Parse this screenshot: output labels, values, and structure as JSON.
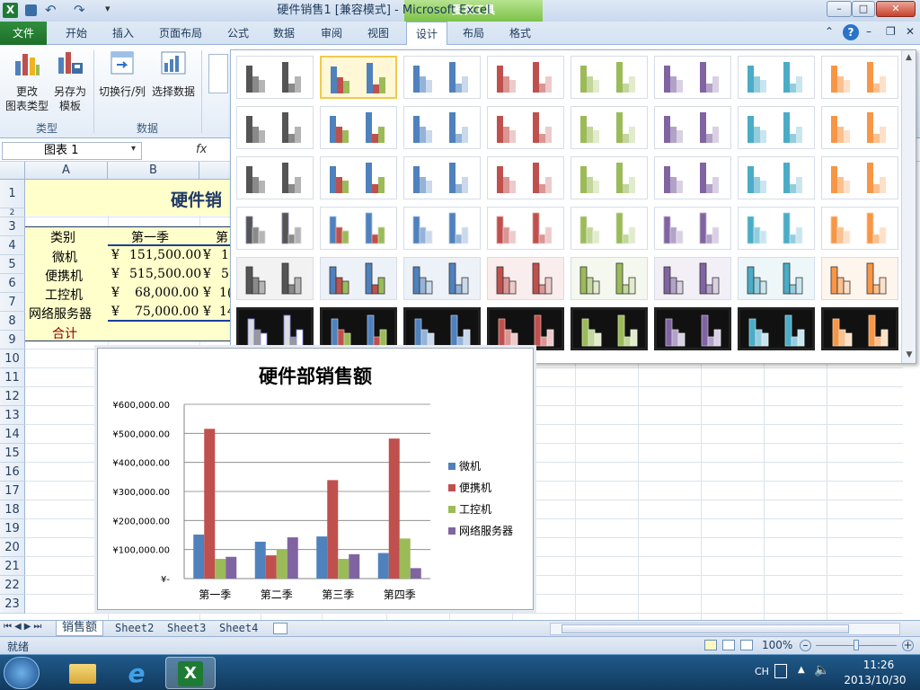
{
  "window": {
    "title": "硬件销售1 [兼容模式] - Microsoft Excel",
    "context_header": "图表工具",
    "controls": {
      "minimize": "–",
      "maximize": "□",
      "close": "✕"
    }
  },
  "ribbon_tabs": [
    {
      "label": "文件"
    },
    {
      "label": "开始"
    },
    {
      "label": "插入"
    },
    {
      "label": "页面布局"
    },
    {
      "label": "公式"
    },
    {
      "label": "数据"
    },
    {
      "label": "审阅"
    },
    {
      "label": "视图"
    },
    {
      "label": "设计"
    },
    {
      "label": "布局"
    },
    {
      "label": "格式"
    }
  ],
  "ribbon": {
    "change_type_label": "更改\n图表类型",
    "save_template_label": "另存为\n模板",
    "switch_row_col_label": "切换行/列",
    "select_data_label": "选择数据",
    "group_type": "类型",
    "group_data": "数据"
  },
  "formula_bar": {
    "name_box": "图表 1",
    "fx": "fx"
  },
  "sheet": {
    "columns": [
      "A",
      "B"
    ],
    "rows": [
      "1",
      "2",
      "3",
      "4",
      "5",
      "6",
      "7",
      "8",
      "9",
      "10",
      "11",
      "12",
      "13",
      "14",
      "15",
      "16",
      "17",
      "18",
      "19",
      "20",
      "21",
      "22",
      "23"
    ],
    "title": "硬件销",
    "header": [
      "类别",
      "第一季",
      "第"
    ],
    "data": [
      [
        "微机",
        "¥",
        "151,500.00",
        "¥",
        "1"
      ],
      [
        "便携机",
        "¥",
        "515,500.00",
        "¥",
        "5"
      ],
      [
        "工控机",
        "¥",
        "68,000.00",
        "¥",
        "1("
      ],
      [
        "网络服务器",
        "¥",
        "75,000.00",
        "¥",
        "14"
      ]
    ],
    "total_label": "合计"
  },
  "chart_data": {
    "type": "bar",
    "title": "硬件部销售额",
    "categories": [
      "第一季",
      "第二季",
      "第三季",
      "第四季"
    ],
    "series": [
      {
        "name": "微机",
        "color": "#4f81bd",
        "values": [
          151500,
          127000,
          145000,
          88000
        ]
      },
      {
        "name": "便携机",
        "color": "#c0504d",
        "values": [
          515500,
          80000,
          339000,
          482000
        ]
      },
      {
        "name": "工控机",
        "color": "#9bbb59",
        "values": [
          68000,
          100000,
          68000,
          138000
        ]
      },
      {
        "name": "网络服务器",
        "color": "#8064a2",
        "values": [
          75000,
          142000,
          84000,
          36000
        ]
      }
    ],
    "yticks": [
      "¥-",
      "¥100,000.00",
      "¥200,000.00",
      "¥300,000.00",
      "¥400,000.00",
      "¥500,000.00",
      "¥600,000.00"
    ],
    "ylim": [
      0,
      600000
    ],
    "legend": "right",
    "grid": true
  },
  "gallery": {
    "palette": [
      "#7f7f7f",
      "#4f81bd",
      "#4f81bd",
      "#c0504d",
      "#9bbb59",
      "#8064a2",
      "#4bacc6",
      "#f79646"
    ],
    "selected_index": 1
  },
  "sheet_tabs": [
    {
      "label": "销售额"
    },
    {
      "label": "Sheet2"
    },
    {
      "label": "Sheet3"
    },
    {
      "label": "Sheet4"
    }
  ],
  "status": {
    "ready": "就绪",
    "zoom": "100%"
  },
  "taskbar": {
    "lang": "CH",
    "time": "11:26",
    "date": "2013/10/30"
  }
}
